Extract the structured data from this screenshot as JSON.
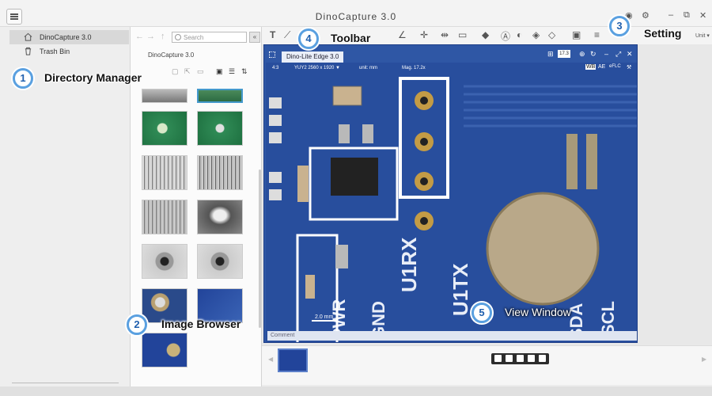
{
  "window": {
    "title": "DinoCapture 3.0",
    "minimize_icon": "minimize-icon",
    "restore_icon": "restore-icon",
    "close_icon": "close-icon"
  },
  "sidebar": {
    "items": [
      {
        "label": "DinoCapture 3.0",
        "icon": "home-icon"
      },
      {
        "label": "Trash Bin",
        "icon": "trash-icon"
      }
    ]
  },
  "browser": {
    "search_placeholder": "Search",
    "folder": "DinoCapture 3.0"
  },
  "toolbar": {
    "unit_label": "Unit ▾"
  },
  "view_window": {
    "tab": "Dino-Lite Edge 3.0",
    "zoom": "17.3",
    "info": {
      "ratio": "4:3",
      "format": "YUY2 2560 x 1920 ▼",
      "unit": "unit: mm",
      "mag": "Mag. 17.2x"
    },
    "right_tools": [
      "WB",
      "AE",
      "eFLC"
    ],
    "scale": "2.0 mm",
    "comment": "Comment"
  },
  "callouts": [
    {
      "number": "1",
      "label": "Directory Manager"
    },
    {
      "number": "2",
      "label": "Image Browser"
    },
    {
      "number": "3",
      "label": "Setting"
    },
    {
      "number": "4",
      "label": "Toolbar"
    },
    {
      "number": "5",
      "label": "View Window"
    }
  ],
  "colors": {
    "accent": "#2f57a5",
    "callout_border": "#5aa0e0"
  }
}
